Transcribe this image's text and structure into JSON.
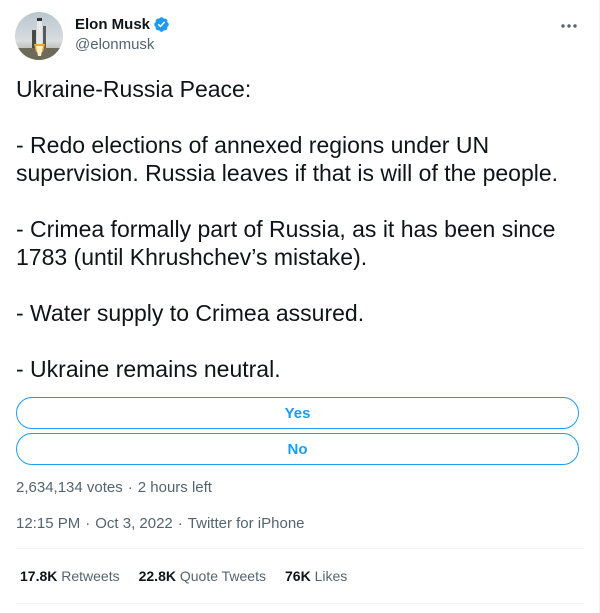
{
  "author": {
    "name": "Elon Musk",
    "handle": "@elonmusk",
    "verified": true
  },
  "tweet": {
    "lines": [
      "Ukraine-Russia Peace:",
      "- Redo elections of annexed regions under UN",
      "supervision. Russia leaves if that is will of the people.",
      "- Crimea formally part of Russia, as it has been since",
      "1783 (until Khrushchev’s mistake).",
      "- Water supply to Crimea assured.",
      "- Ukraine remains neutral."
    ]
  },
  "poll": {
    "options": [
      "Yes",
      "No"
    ],
    "votes": "2,634,134 votes",
    "separator": "·",
    "time_left": "2 hours left"
  },
  "meta": {
    "time": "12:15 PM",
    "separator": "·",
    "date": "Oct 3, 2022",
    "client": "Twitter for iPhone"
  },
  "stats": {
    "retweets": {
      "count": "17.8K",
      "label": "Retweets"
    },
    "quotes": {
      "count": "22.8K",
      "label": "Quote Tweets"
    },
    "likes": {
      "count": "76K",
      "label": "Likes"
    }
  },
  "colors": {
    "accent": "#1d9bf0",
    "text": "#0f1419",
    "secondary": "#536471",
    "divider": "#eff3f4"
  },
  "icons": {
    "verified": "verified-badge-icon",
    "more": "more-horizontal-icon"
  }
}
